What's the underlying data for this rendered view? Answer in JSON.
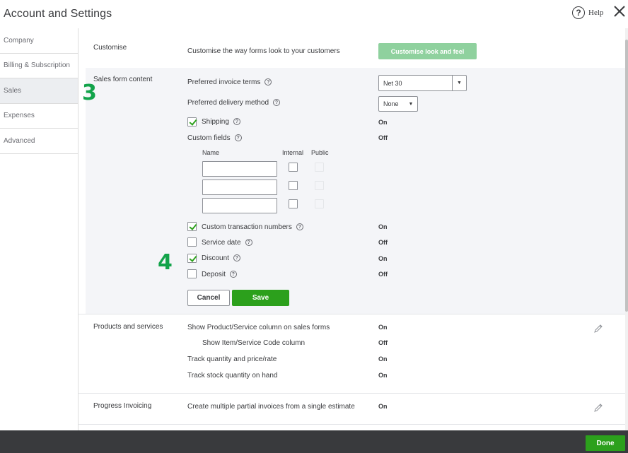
{
  "window": {
    "title": "Account and Settings",
    "help_label": "Help"
  },
  "sidebar": {
    "items": [
      {
        "label": "Company"
      },
      {
        "label": "Billing & Subscription"
      },
      {
        "label": "Sales",
        "active": true
      },
      {
        "label": "Expenses"
      },
      {
        "label": "Advanced"
      }
    ]
  },
  "customise": {
    "title": "Customise",
    "description": "Customise the way forms look to your customers",
    "button_label": "Customise look and feel"
  },
  "sales_form_content": {
    "title": "Sales form content",
    "preferred_invoice_terms": {
      "label": "Preferred invoice terms",
      "value": "Net 30"
    },
    "preferred_delivery_method": {
      "label": "Preferred delivery method",
      "value": "None"
    },
    "shipping": {
      "label": "Shipping",
      "checked": true,
      "status": "On"
    },
    "custom_fields": {
      "label": "Custom fields",
      "status": "Off",
      "col_name": "Name",
      "col_internal": "Internal",
      "col_public": "Public"
    },
    "custom_transaction_numbers": {
      "label": "Custom transaction numbers",
      "checked": true,
      "status": "On"
    },
    "service_date": {
      "label": "Service date",
      "checked": false,
      "status": "Off"
    },
    "discount": {
      "label": "Discount",
      "checked": true,
      "status": "On"
    },
    "deposit": {
      "label": "Deposit",
      "checked": false,
      "status": "Off"
    },
    "cancel_label": "Cancel",
    "save_label": "Save"
  },
  "products_and_services": {
    "title": "Products and services",
    "rows": [
      {
        "label": "Show Product/Service column on sales forms",
        "status": "On"
      },
      {
        "label": "Show Item/Service Code column",
        "status": "Off"
      },
      {
        "label": "Track quantity and price/rate",
        "status": "On"
      },
      {
        "label": "Track stock quantity on hand",
        "status": "On"
      }
    ]
  },
  "progress_invoicing": {
    "title": "Progress Invoicing",
    "description": "Create multiple partial invoices from a single estimate",
    "status": "On"
  },
  "annotations": {
    "step_a": "3",
    "step_b": "4"
  },
  "footer": {
    "done_label": "Done"
  },
  "colors": {
    "accent_green": "#2ca01c",
    "annotation_green": "#12a34a",
    "footer_bg": "#393a3d"
  }
}
